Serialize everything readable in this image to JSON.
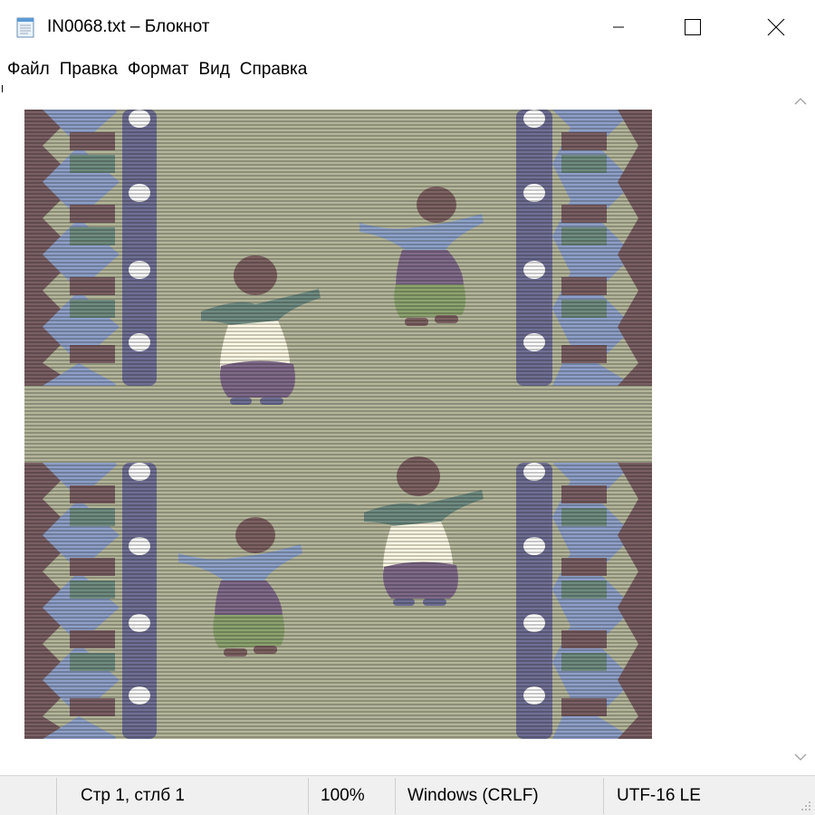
{
  "window": {
    "title": "IN0068.txt – Блокнот",
    "icon": "notepad-icon",
    "controls": [
      "minimize-icon",
      "maximize-icon",
      "close-icon"
    ]
  },
  "menu": {
    "file": "Файл",
    "edit": "Правка",
    "format": "Формат",
    "view": "Вид",
    "help": "Справка"
  },
  "editor": {
    "content": "ASCII-art picture: dancing figures between zigzag borders",
    "colors": {
      "background": "#b4b69a",
      "stripe": "#7f8174",
      "border_blue": "#8ea0c8",
      "border_purple": "#6f6f95",
      "border_brown": "#7a5f63",
      "border_green": "#6f8c80",
      "figure_teal": "#6f8c82",
      "figure_blue": "#8ea3c9",
      "skirt_cream": "#fffbe6",
      "skirt_purple": "#806a8a",
      "skirt_green": "#8da470",
      "head_brown": "#7e6262"
    }
  },
  "status": {
    "position": "Стр 1, стлб 1",
    "zoom": "100%",
    "line_ending": "Windows (CRLF)",
    "encoding": "UTF-16 LE"
  }
}
